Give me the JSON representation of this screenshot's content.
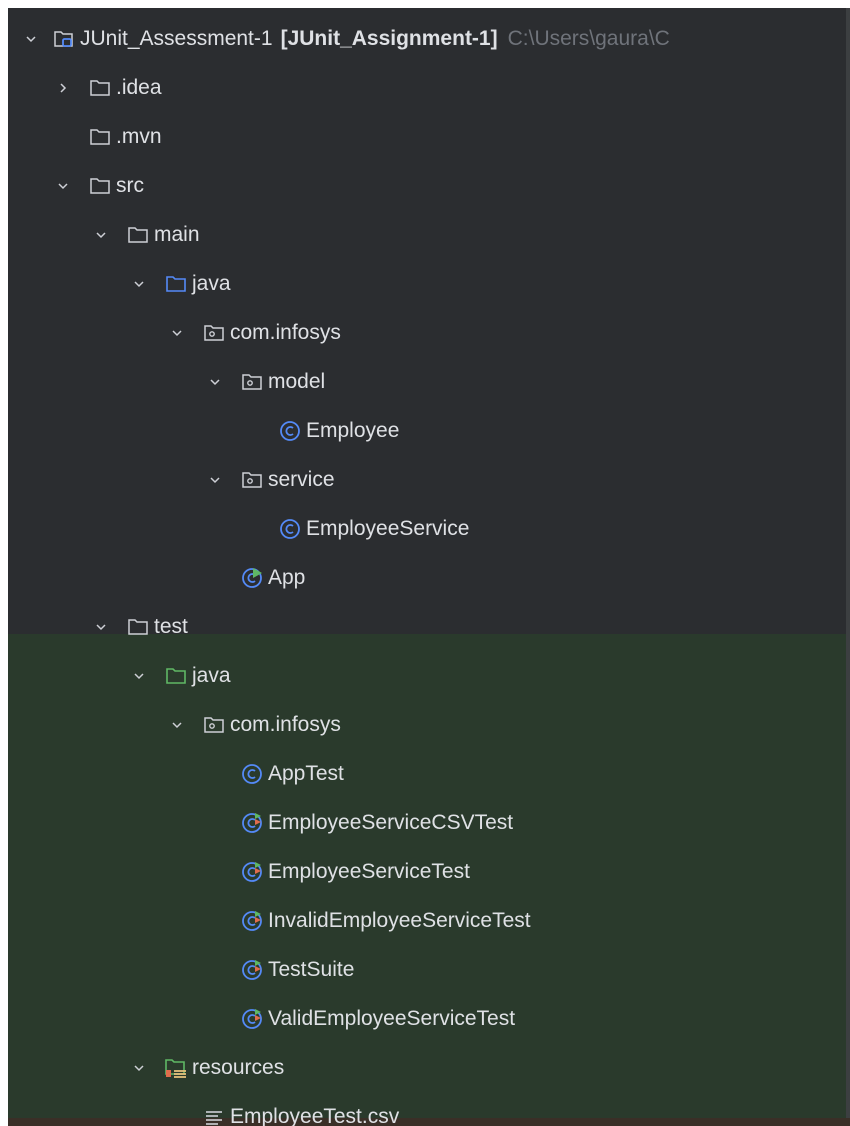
{
  "project": {
    "name": "JUnit_Assessment-1",
    "module": "[JUnit_Assignment-1]",
    "path": "C:\\Users\\gaura\\C"
  },
  "nodes": [
    {
      "id": "project-root",
      "label": "JUnit_Assessment-1",
      "icon": "module-folder-icon",
      "expanded": true
    },
    {
      "id": "folder-idea",
      "label": ".idea",
      "icon": "folder-icon",
      "expanded": false
    },
    {
      "id": "folder-mvn",
      "label": ".mvn",
      "icon": "folder-icon"
    },
    {
      "id": "folder-src",
      "label": "src",
      "icon": "folder-icon",
      "expanded": true
    },
    {
      "id": "folder-main",
      "label": "main",
      "icon": "folder-icon",
      "expanded": true
    },
    {
      "id": "folder-main-java",
      "label": "java",
      "icon": "source-root-folder-icon",
      "expanded": true
    },
    {
      "id": "package-main",
      "label": "com.infosys",
      "icon": "package-icon",
      "expanded": true
    },
    {
      "id": "package-model",
      "label": "model",
      "icon": "package-icon",
      "expanded": true
    },
    {
      "id": "class-employee",
      "label": "Employee",
      "icon": "class-icon"
    },
    {
      "id": "package-service",
      "label": "service",
      "icon": "package-icon",
      "expanded": true
    },
    {
      "id": "class-employeeservice",
      "label": "EmployeeService",
      "icon": "class-icon"
    },
    {
      "id": "class-app",
      "label": "App",
      "icon": "runnable-class-icon"
    },
    {
      "id": "folder-test",
      "label": "test",
      "icon": "folder-icon",
      "expanded": true
    },
    {
      "id": "folder-test-java",
      "label": "java",
      "icon": "test-root-folder-icon",
      "expanded": true
    },
    {
      "id": "package-test",
      "label": "com.infosys",
      "icon": "package-icon",
      "expanded": true
    },
    {
      "id": "class-apptest",
      "label": "AppTest",
      "icon": "class-icon"
    },
    {
      "id": "class-csvtest",
      "label": "EmployeeServiceCSVTest",
      "icon": "test-class-icon"
    },
    {
      "id": "class-servicetest",
      "label": "EmployeeServiceTest",
      "icon": "test-class-icon"
    },
    {
      "id": "class-invalidtest",
      "label": "InvalidEmployeeServiceTest",
      "icon": "test-class-icon"
    },
    {
      "id": "class-testsuite",
      "label": "TestSuite",
      "icon": "test-class-icon"
    },
    {
      "id": "class-validtest",
      "label": "ValidEmployeeServiceTest",
      "icon": "test-class-icon"
    },
    {
      "id": "folder-resources",
      "label": "resources",
      "icon": "test-resources-folder-icon",
      "expanded": true
    },
    {
      "id": "file-csv",
      "label": "EmployeeTest.csv",
      "icon": "text-file-icon"
    }
  ],
  "colors": {
    "background": "#2b2d30",
    "test_highlight": "#2a3a2c",
    "text": "#dfe1e5",
    "path_text": "#6f737a",
    "folder_stroke": "#ced0d6",
    "source_root": "#548af7",
    "test_root": "#5fb865",
    "class_icon": "#548af7",
    "test_marker": "#e06c4c"
  }
}
